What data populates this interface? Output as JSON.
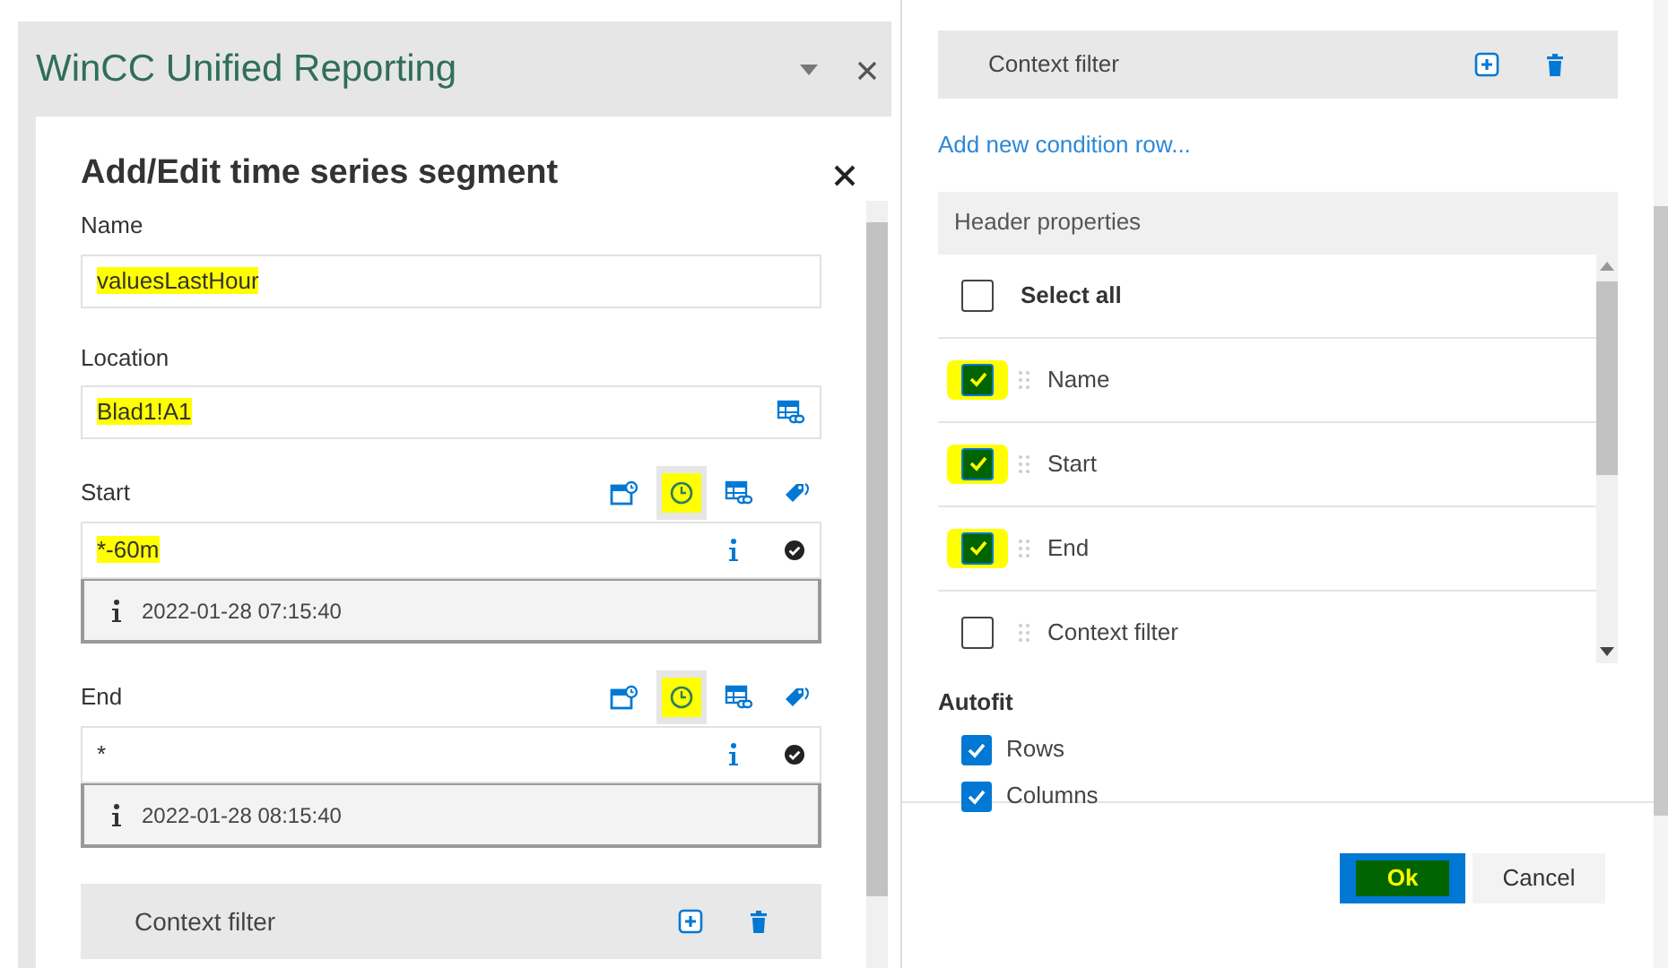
{
  "pane": {
    "title": "WinCC Unified Reporting"
  },
  "dialog": {
    "title": "Add/Edit time series segment",
    "name": {
      "label": "Name",
      "value": "valuesLastHour",
      "highlighted": true
    },
    "location": {
      "label": "Location",
      "value": "Blad1!A1",
      "highlighted": true
    },
    "time_fields": [
      {
        "label": "Start",
        "value": "*-60m",
        "highlighted": true,
        "resolved": "2022-01-28 07:15:40",
        "modes": [
          {
            "kind": "calendar",
            "selected": false,
            "highlighted": false
          },
          {
            "kind": "clock",
            "selected": true,
            "highlighted": true
          },
          {
            "kind": "table-link",
            "selected": false,
            "highlighted": false
          },
          {
            "kind": "tag",
            "selected": false,
            "highlighted": false
          }
        ]
      },
      {
        "label": "End",
        "value": "*",
        "highlighted": false,
        "resolved": "2022-01-28 08:15:40",
        "modes": [
          {
            "kind": "calendar",
            "selected": false,
            "highlighted": false
          },
          {
            "kind": "clock",
            "selected": true,
            "highlighted": true
          },
          {
            "kind": "table-link",
            "selected": false,
            "highlighted": false
          },
          {
            "kind": "tag",
            "selected": false,
            "highlighted": false
          }
        ]
      }
    ],
    "context_filter": {
      "label": "Context filter"
    }
  },
  "settings": {
    "context_filter": {
      "label": "Context filter"
    },
    "add_link": "Add new condition row...",
    "header_properties": {
      "title": "Header properties",
      "select_all": {
        "label": "Select all",
        "checked": false
      },
      "items": [
        {
          "label": "Name",
          "checked": true,
          "highlighted": true
        },
        {
          "label": "Start",
          "checked": true,
          "highlighted": true
        },
        {
          "label": "End",
          "checked": true,
          "highlighted": true
        },
        {
          "label": "Context filter",
          "checked": false,
          "highlighted": false
        }
      ]
    },
    "autofit": {
      "title": "Autofit",
      "items": [
        {
          "label": "Rows",
          "checked": true
        },
        {
          "label": "Columns",
          "checked": true
        }
      ]
    },
    "buttons": [
      {
        "label": "Ok",
        "kind": "primary",
        "highlighted": true
      },
      {
        "label": "Cancel",
        "kind": "secondary",
        "highlighted": false
      }
    ]
  }
}
